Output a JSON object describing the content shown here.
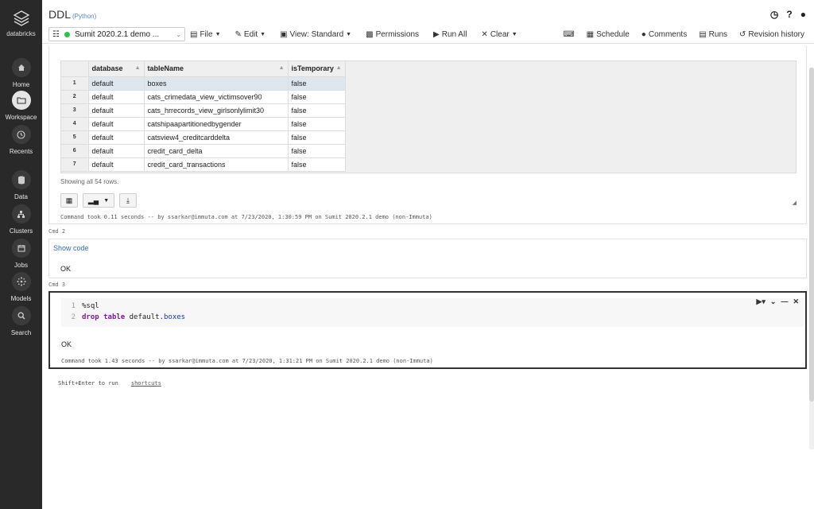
{
  "sidebar": {
    "brand": "databricks",
    "items": [
      {
        "label": "Home",
        "icon": "home-icon"
      },
      {
        "label": "Workspace",
        "icon": "folder-icon"
      },
      {
        "label": "Recents",
        "icon": "clock-icon"
      },
      {
        "label": "Data",
        "icon": "database-icon"
      },
      {
        "label": "Clusters",
        "icon": "cluster-icon"
      },
      {
        "label": "Jobs",
        "icon": "calendar-icon"
      },
      {
        "label": "Models",
        "icon": "models-icon"
      },
      {
        "label": "Search",
        "icon": "search-icon"
      }
    ]
  },
  "header": {
    "title": "DDL",
    "language": "(Python)",
    "cluster": "Sumit 2020.2.1 demo ...",
    "menu": {
      "file": "File",
      "edit": "Edit",
      "view": "View: Standard",
      "permissions": "Permissions",
      "run_all": "Run All",
      "clear": "Clear"
    },
    "right": {
      "schedule": "Schedule",
      "comments": "Comments",
      "runs": "Runs",
      "revision_history": "Revision history"
    }
  },
  "cell1": {
    "columns": [
      "database",
      "tableName",
      "isTemporary"
    ],
    "rows": [
      [
        "1",
        "default",
        "boxes",
        "false"
      ],
      [
        "2",
        "default",
        "cats_crimedata_view_victimsover90",
        "false"
      ],
      [
        "3",
        "default",
        "cats_hrrecords_view_girlsonlylimit30",
        "false"
      ],
      [
        "4",
        "default",
        "catshipaapartitionedbygender",
        "false"
      ],
      [
        "5",
        "default",
        "catsview4_creditcarddelta",
        "false"
      ],
      [
        "6",
        "default",
        "credit_card_delta",
        "false"
      ],
      [
        "7",
        "default",
        "credit_card_transactions",
        "false"
      ]
    ],
    "row_note": "Showing all 54 rows.",
    "command_took": "Command took 0.11 seconds -- by ssarkar@immuta.com at 7/23/2020, 1:30:59 PM on Sumit 2020.2.1 demo (non-Immuta)"
  },
  "cell2": {
    "label": "Cmd 2",
    "show_code": "Show code",
    "output": "OK"
  },
  "cell3": {
    "label": "Cmd 3",
    "code": {
      "line1_num": "1",
      "line1": "%sql",
      "line2_num": "2",
      "line2_kw1": "drop",
      "line2_kw2": "table",
      "line2_schema": "default",
      "line2_dot": ".",
      "line2_obj": "boxes"
    },
    "output": "OK",
    "command_took": "Command took 1.43 seconds -- by ssarkar@immuta.com at 7/23/2020, 1:31:21 PM on Sumit 2020.2.1 demo (non-Immuta)"
  },
  "footer": {
    "hint": "Shift+Enter to run",
    "shortcuts": "shortcuts"
  },
  "colors": {
    "sidebar_bg": "#292929",
    "cluster_running": "#2fbf4b",
    "link": "#2a6ebb",
    "sql_keyword": "#7a1d8f"
  }
}
